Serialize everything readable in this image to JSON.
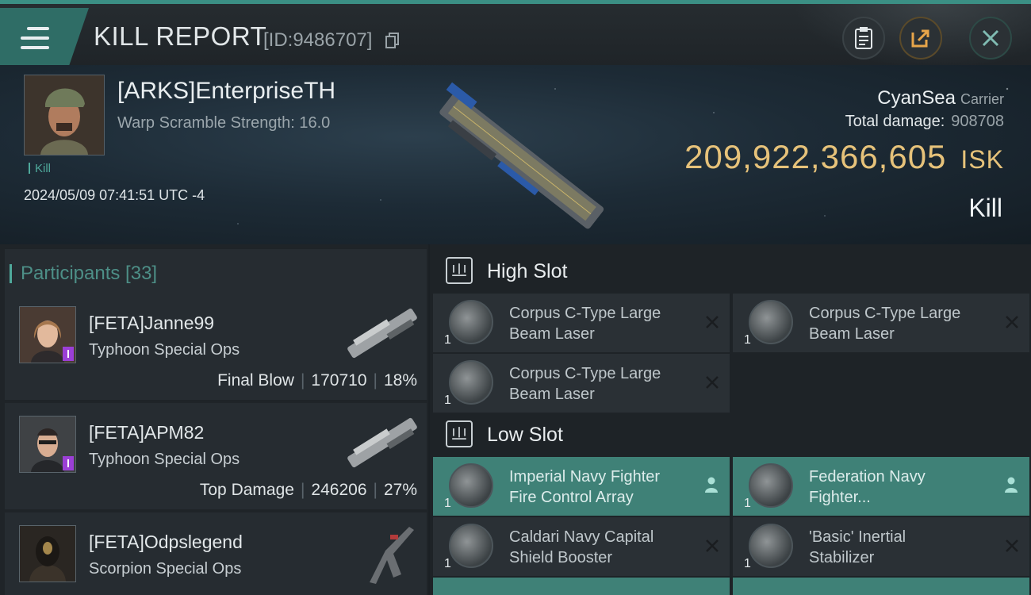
{
  "header": {
    "title": "KILL REPORT",
    "report_id": "[ID:9486707]"
  },
  "victim": {
    "name": "[ARKS]EnterpriseTH",
    "warp_scramble": "Warp Scramble Strength: 16.0",
    "tag": "Kill",
    "timestamp": "2024/05/09 07:41:51 UTC -4",
    "ship_name": "CyanSea",
    "ship_class": "Carrier",
    "total_damage_label": "Total damage:",
    "total_damage_value": "908708",
    "isk_value": "209,922,366,605",
    "isk_unit": "ISK",
    "kill_type": "Kill"
  },
  "participants": {
    "label": "Participants [33]",
    "rows": [
      {
        "name": "[FETA]Janne99",
        "ship": "Typhoon Special Ops",
        "role": "Final Blow",
        "damage": "170710",
        "percent": "18%"
      },
      {
        "name": "[FETA]APM82",
        "ship": "Typhoon Special Ops",
        "role": "Top Damage",
        "damage": "246206",
        "percent": "27%"
      },
      {
        "name": "[FETA]Odpslegend",
        "ship": "Scorpion Special Ops"
      }
    ]
  },
  "slots": {
    "high": {
      "title": "High Slot",
      "modules": [
        {
          "qty": "1",
          "line1": "Corpus C-Type Large",
          "line2": "Beam Laser"
        },
        {
          "qty": "1",
          "line1": "Corpus C-Type Large",
          "line2": "Beam Laser"
        },
        {
          "qty": "1",
          "line1": "Corpus C-Type Large",
          "line2": "Beam Laser"
        }
      ]
    },
    "low": {
      "title": "Low Slot",
      "modules": [
        {
          "qty": "1",
          "line1": "Imperial Navy Fighter",
          "line2": "Fire Control Array"
        },
        {
          "qty": "1",
          "line1": "Federation Navy",
          "line2": "Fighter..."
        },
        {
          "qty": "1",
          "line1": "Caldari Navy Capital",
          "line2": "Shield Booster"
        },
        {
          "qty": "1",
          "line1": "'Basic' Inertial",
          "line2": "Stabilizer"
        }
      ]
    }
  },
  "colors": {
    "accent": "#3b8f84",
    "isk": "#e6c27a",
    "active_row": "#3f8177"
  }
}
